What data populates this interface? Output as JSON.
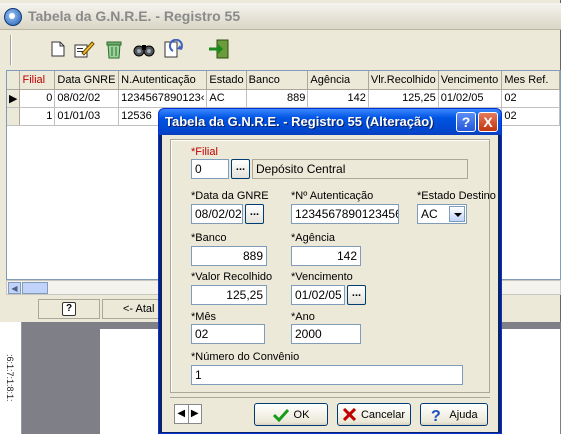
{
  "bg_window": {
    "title": "Tabela da G.N.R.E. - Registro 55",
    "toolbar": [
      "new-icon",
      "edit-icon",
      "delete-icon",
      "search-icon",
      "refresh-icon",
      "exit-icon"
    ],
    "grid": {
      "headers": [
        "Filial",
        "Data GNRE",
        "N.Autenticação",
        "Estado",
        "Banco",
        "Agência",
        "Vlr.Recolhido",
        "Vencimento",
        "Mes Ref."
      ],
      "rows": [
        [
          "0",
          "08/02/02",
          "1234567890123‹",
          "AC",
          "889",
          "142",
          "125,25",
          "01/02/05",
          "02"
        ],
        [
          "1",
          "01/01/03",
          "12536",
          "",
          "",
          "",
          "",
          "",
          "02"
        ]
      ]
    },
    "status": {
      "help_label": "?",
      "shortcut_label": "<- Atal"
    },
    "ruler_text": ":6:1:7:1:8:1:"
  },
  "dialog": {
    "title": "Tabela da G.N.R.E. - Registro 55 (Alteração)",
    "help_caption": "?",
    "close_caption": "X",
    "fields": {
      "filial": {
        "label": "*Filial",
        "value": "0",
        "description": "Depósito Central"
      },
      "data_gnre": {
        "label": "*Data da GNRE",
        "value": "08/02/02"
      },
      "autenticacao": {
        "label": "*Nº Autenticação",
        "value": "12345678901234567"
      },
      "estado": {
        "label": "*Estado Destino",
        "value": "AC"
      },
      "banco": {
        "label": "*Banco",
        "value": "889"
      },
      "agencia": {
        "label": "*Agência",
        "value": "142"
      },
      "valor": {
        "label": "*Valor Recolhido",
        "value": "125,25"
      },
      "vencimento": {
        "label": "*Vencimento",
        "value": "01/02/05"
      },
      "mes": {
        "label": "*Mês",
        "value": "02"
      },
      "ano": {
        "label": "*Ano",
        "value": "2000"
      },
      "convenio": {
        "label": "*Número do Convênio",
        "value": "1"
      }
    },
    "dots_label": "...",
    "buttons": {
      "ok": "OK",
      "cancel": "Cancelar",
      "help": "Ajuda"
    },
    "nav": {
      "prev": "◀",
      "next": "▶"
    }
  },
  "colors": {
    "required_label": "#c00000",
    "title_bar": "#0054e3"
  }
}
